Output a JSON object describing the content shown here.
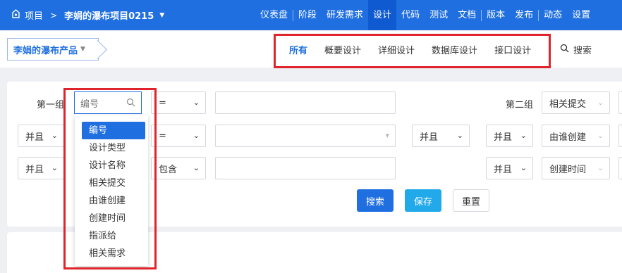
{
  "topbar": {
    "project_label": "项目",
    "separator": ">",
    "project_name": "李娟的瀑布项目0215",
    "nav": [
      "仪表盘",
      "阶段",
      "研发需求",
      "设计",
      "代码",
      "测试",
      "文档",
      "版本",
      "发布",
      "动态",
      "设置"
    ],
    "active_nav": "设计"
  },
  "subbar": {
    "product": "李娟的瀑布产品",
    "tabs": [
      "所有",
      "概要设计",
      "详细设计",
      "数据库设计",
      "接口设计"
    ],
    "active_tab": "所有",
    "search": "搜索"
  },
  "form": {
    "group1_label": "第一组",
    "group2_label": "第二组",
    "row1": {
      "op": "=",
      "g2_field": "相关提交"
    },
    "row2": {
      "logic": "并且",
      "op": "=",
      "mid_logic": "并且",
      "g2_logic": "并且",
      "g2_field": "由谁创建"
    },
    "row3": {
      "logic": "并且",
      "op": "包含",
      "g2_logic": "并且",
      "g2_field": "创建时间"
    },
    "buttons": {
      "search": "搜索",
      "save": "保存",
      "reset": "重置"
    }
  },
  "field_dropdown": {
    "search_placeholder": "编号",
    "options": [
      "编号",
      "设计类型",
      "设计名称",
      "相关提交",
      "由谁创建",
      "创建时间",
      "指派给",
      "相关需求"
    ],
    "highlighted": "编号"
  },
  "colors": {
    "brand": "#1f6fe0",
    "highlight_border": "#e0242b",
    "save_button": "#22a9ea"
  }
}
